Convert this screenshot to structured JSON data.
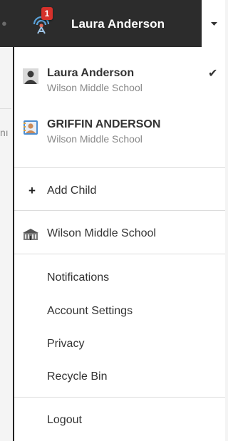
{
  "header": {
    "notification_count": "1",
    "user_name": "Laura Anderson"
  },
  "background": {
    "fragment_text": "nı"
  },
  "dropdown": {
    "accounts": [
      {
        "name": "Laura Anderson",
        "school": "Wilson Middle School",
        "selected_mark": "✔",
        "icon": "person-icon"
      },
      {
        "name": "GRIFFIN ANDERSON",
        "school": "Wilson Middle School",
        "icon": "student-id-icon"
      }
    ],
    "add_child_label": "Add Child",
    "school_label": "Wilson Middle School",
    "menu_items": [
      "Notifications",
      "Account Settings",
      "Privacy",
      "Recycle Bin"
    ],
    "logout_label": "Logout"
  },
  "colors": {
    "topbar": "#2c2c2c",
    "badge": "#d6312b",
    "separator": "#dcdcdc",
    "secondary_text": "#888888"
  }
}
